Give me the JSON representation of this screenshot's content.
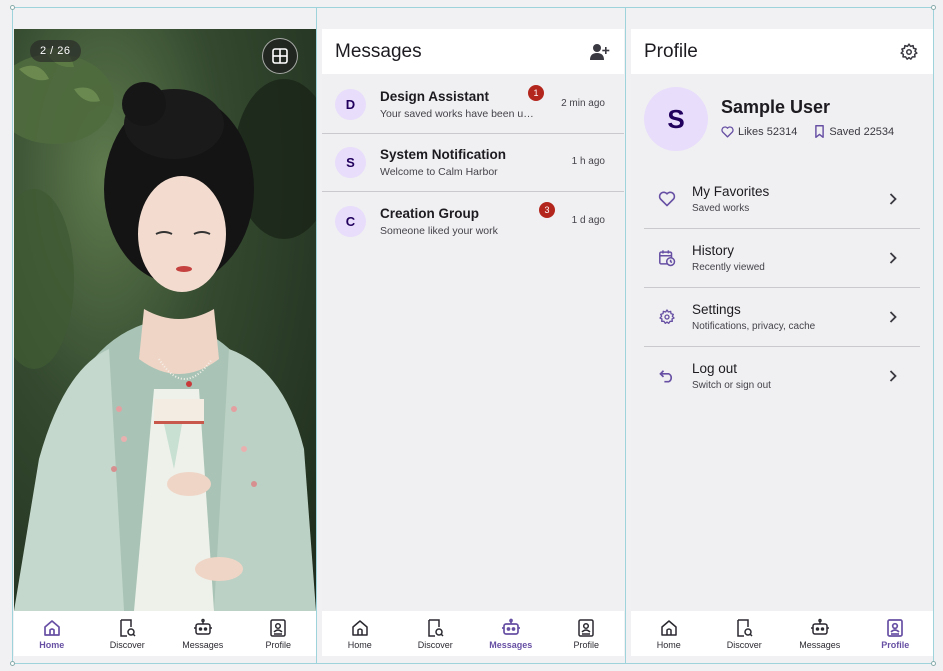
{
  "viewer": {
    "counter": "2 / 26"
  },
  "messages": {
    "title": "Messages",
    "items": [
      {
        "initial": "D",
        "title": "Design Assistant",
        "subtitle": "Your saved works have been u…",
        "badge": "1",
        "time": "2 min ago"
      },
      {
        "initial": "S",
        "title": "System Notification",
        "subtitle": "Welcome to Calm Harbor",
        "badge": "",
        "time": "1 h ago"
      },
      {
        "initial": "C",
        "title": "Creation Group",
        "subtitle": "Someone liked your work",
        "badge": "3",
        "time": "1 d ago"
      }
    ]
  },
  "profile": {
    "title": "Profile",
    "initial": "S",
    "name": "Sample User",
    "likes": "Likes 52314",
    "saved": "Saved 22534",
    "menu": [
      {
        "icon": "heart-icon",
        "title": "My Favorites",
        "subtitle": "Saved works"
      },
      {
        "icon": "history-icon",
        "title": "History",
        "subtitle": "Recently viewed"
      },
      {
        "icon": "gear-icon",
        "title": "Settings",
        "subtitle": "Notifications, privacy, cache"
      },
      {
        "icon": "logout-icon",
        "title": "Log out",
        "subtitle": "Switch or sign out"
      }
    ]
  },
  "nav": {
    "home": "Home",
    "discover": "Discover",
    "messages": "Messages",
    "profile": "Profile"
  },
  "colors": {
    "accent": "#6750a4",
    "avatar_bg": "#e8ddfb",
    "badge": "#b3261e",
    "guide": "#9fd3dc"
  }
}
